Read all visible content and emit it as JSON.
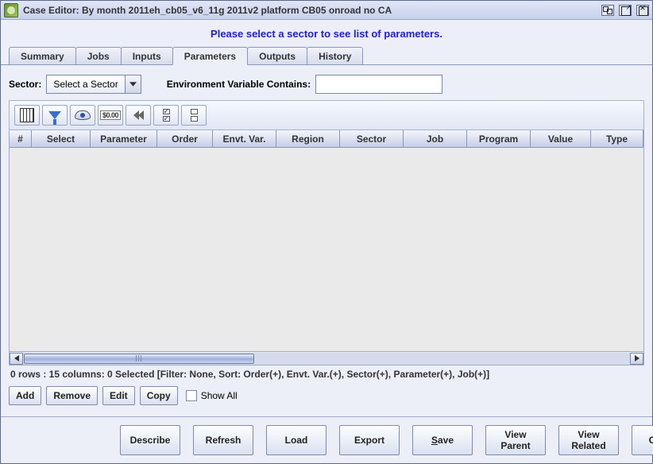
{
  "window": {
    "title": "Case Editor: By month 2011eh_cb05_v6_11g 2011v2 platform CB05 onroad no CA"
  },
  "instruction": "Please select a sector to see list of parameters.",
  "tabs": {
    "t0": "Summary",
    "t1": "Jobs",
    "t2": "Inputs",
    "t3": "Parameters",
    "t4": "Outputs",
    "t5": "History"
  },
  "filters": {
    "sector_label": "Sector:",
    "sector_selected": "Select a Sector",
    "env_label": "Environment Variable Contains:",
    "env_value": ""
  },
  "columns": {
    "c0": "#",
    "c1": "Select",
    "c2": "Parameter",
    "c3": "Order",
    "c4": "Envt. Var.",
    "c5": "Region",
    "c6": "Sector",
    "c7": "Job",
    "c8": "Program",
    "c9": "Value",
    "c10": "Type"
  },
  "status": "0 rows : 15 columns: 0 Selected [Filter: None, Sort: Order(+), Envt. Var.(+), Sector(+), Parameter(+), Job(+)]",
  "row_buttons": {
    "add": "Add",
    "remove": "Remove",
    "edit": "Edit",
    "copy": "Copy",
    "show_all": "Show All"
  },
  "bottom_buttons": {
    "describe": "Describe",
    "refresh": "Refresh",
    "load": "Load",
    "export": "Export",
    "save_pre": "S",
    "save_post": "ave",
    "view_parent": "View Parent",
    "view_related": "View Related",
    "close": "Close"
  },
  "toolbar_icons": {
    "columns": "columns-icon",
    "filter": "filter-icon",
    "preview": "eye-icon",
    "format": "format-icon",
    "reset": "rewind-icon",
    "check_all": "check-all-icon",
    "uncheck_all": "uncheck-all-icon"
  }
}
